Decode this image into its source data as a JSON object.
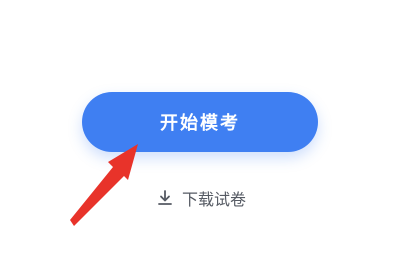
{
  "start_button": {
    "label": "开始模考"
  },
  "download_link": {
    "label": "下载试卷",
    "icon": "download-icon"
  },
  "colors": {
    "primary": "#3f7ff2",
    "text_secondary": "#555a63",
    "arrow": "#e8332a"
  },
  "annotation": {
    "icon": "red-arrow-icon"
  }
}
